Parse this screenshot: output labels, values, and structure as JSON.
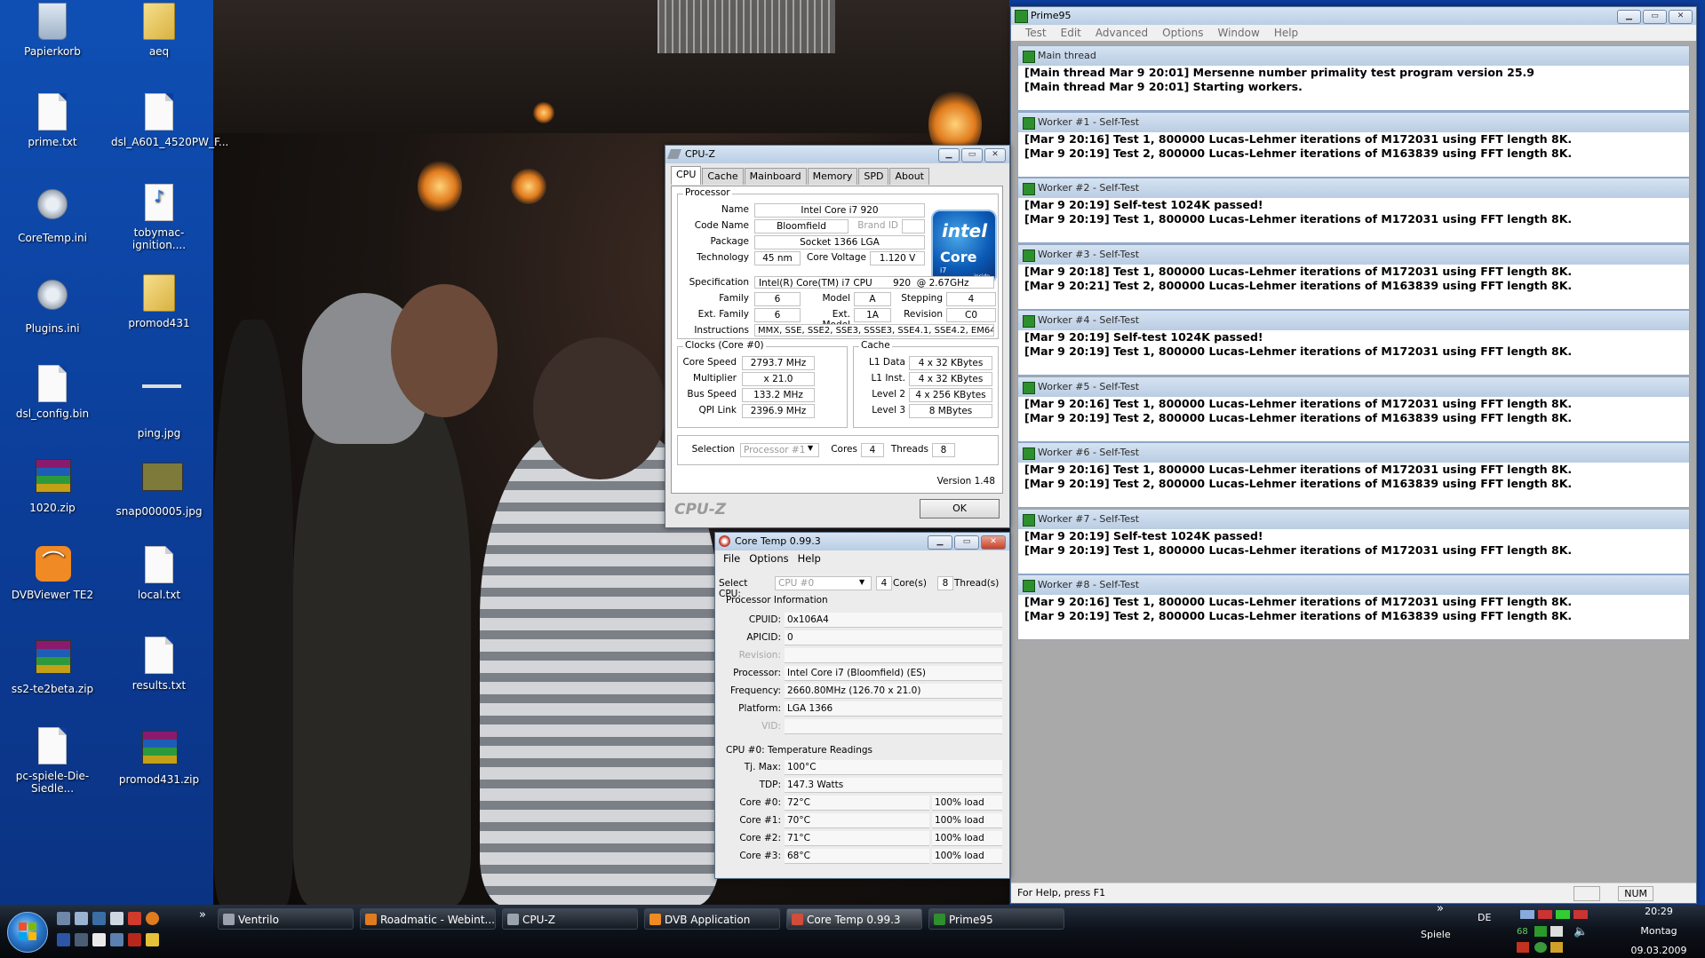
{
  "desktop_icons": [
    {
      "label": "Papierkorb",
      "kind": "recycle-bin"
    },
    {
      "label": "aeq",
      "kind": "folder"
    },
    {
      "label": "prime.txt",
      "kind": "text-file"
    },
    {
      "label": "dsl_A601_4520PW_F...",
      "kind": "text-file"
    },
    {
      "label": "CoreTemp.ini",
      "kind": "ini-file"
    },
    {
      "label": "tobymac-ignition....",
      "kind": "mp3-file"
    },
    {
      "label": "Plugins.ini",
      "kind": "ini-file"
    },
    {
      "label": "promod431",
      "kind": "folder"
    },
    {
      "label": "dsl_config.bin",
      "kind": "text-file"
    },
    {
      "label": "ping.jpg",
      "kind": "image-file"
    },
    {
      "label": "1020.zip",
      "kind": "zip-file"
    },
    {
      "label": "snap000005.jpg",
      "kind": "image-file"
    },
    {
      "label": "DVBViewer TE2",
      "kind": "rss-app"
    },
    {
      "label": "local.txt",
      "kind": "text-file"
    },
    {
      "label": "ss2-te2beta.zip",
      "kind": "zip-file"
    },
    {
      "label": "results.txt",
      "kind": "text-file"
    },
    {
      "label": "pc-spiele-Die-Siedle...",
      "kind": "text-file"
    },
    {
      "label": "promod431.zip",
      "kind": "zip-file"
    }
  ],
  "prime95": {
    "title": "Prime95",
    "menu": [
      "Test",
      "Edit",
      "Advanced",
      "Options",
      "Window",
      "Help"
    ],
    "windows": [
      {
        "title": "Main thread",
        "lines": [
          "[Main thread Mar 9 20:01] Mersenne number primality test program version 25.9",
          "[Main thread Mar 9 20:01] Starting workers."
        ]
      },
      {
        "title": "Worker #1 - Self-Test",
        "lines": [
          "[Mar 9 20:16] Test 1, 800000 Lucas-Lehmer iterations of M172031 using FFT length 8K.",
          "[Mar 9 20:19] Test 2, 800000 Lucas-Lehmer iterations of M163839 using FFT length 8K."
        ]
      },
      {
        "title": "Worker #2 - Self-Test",
        "lines": [
          "[Mar 9 20:19] Self-test 1024K passed!",
          "[Mar 9 20:19] Test 1, 800000 Lucas-Lehmer iterations of M172031 using FFT length 8K."
        ]
      },
      {
        "title": "Worker #3 - Self-Test",
        "lines": [
          "[Mar 9 20:18] Test 1, 800000 Lucas-Lehmer iterations of M172031 using FFT length 8K.",
          "[Mar 9 20:21] Test 2, 800000 Lucas-Lehmer iterations of M163839 using FFT length 8K."
        ]
      },
      {
        "title": "Worker #4 - Self-Test",
        "lines": [
          "[Mar 9 20:19] Self-test 1024K passed!",
          "[Mar 9 20:19] Test 1, 800000 Lucas-Lehmer iterations of M172031 using FFT length 8K."
        ]
      },
      {
        "title": "Worker #5 - Self-Test",
        "lines": [
          "[Mar 9 20:16] Test 1, 800000 Lucas-Lehmer iterations of M172031 using FFT length 8K.",
          "[Mar 9 20:19] Test 2, 800000 Lucas-Lehmer iterations of M163839 using FFT length 8K."
        ]
      },
      {
        "title": "Worker #6 - Self-Test",
        "lines": [
          "[Mar 9 20:16] Test 1, 800000 Lucas-Lehmer iterations of M172031 using FFT length 8K.",
          "[Mar 9 20:19] Test 2, 800000 Lucas-Lehmer iterations of M163839 using FFT length 8K."
        ]
      },
      {
        "title": "Worker #7 - Self-Test",
        "lines": [
          "[Mar 9 20:19] Self-test 1024K passed!",
          "[Mar 9 20:19] Test 1, 800000 Lucas-Lehmer iterations of M172031 using FFT length 8K."
        ]
      },
      {
        "title": "Worker #8 - Self-Test",
        "lines": [
          "[Mar 9 20:16] Test 1, 800000 Lucas-Lehmer iterations of M172031 using FFT length 8K.",
          "[Mar 9 20:19] Test 2, 800000 Lucas-Lehmer iterations of M163839 using FFT length 8K."
        ]
      }
    ],
    "status": "For Help, press F1",
    "num_indicator": "NUM"
  },
  "cpuz": {
    "title": "CPU-Z",
    "tabs": [
      "CPU",
      "Cache",
      "Mainboard",
      "Memory",
      "SPD",
      "About"
    ],
    "processor_group": "Processor",
    "labels": {
      "name": "Name",
      "code_name": "Code Name",
      "brand_id": "Brand ID",
      "package": "Package",
      "technology": "Technology",
      "core_voltage": "Core Voltage",
      "specification": "Specification",
      "family": "Family",
      "model": "Model",
      "stepping": "Stepping",
      "ext_family": "Ext. Family",
      "ext_model": "Ext. Model",
      "revision": "Revision",
      "instructions": "Instructions"
    },
    "values": {
      "name": "Intel Core i7 920",
      "code_name": "Bloomfield",
      "package": "Socket 1366 LGA",
      "technology": "45 nm",
      "core_voltage": "1.120 V",
      "specification": "Intel(R) Core(TM) i7 CPU       920  @ 2.67GHz",
      "family": "6",
      "model": "A",
      "stepping": "4",
      "ext_family": "6",
      "ext_model": "1A",
      "revision": "C0",
      "instructions": "MMX, SSE, SSE2, SSE3, SSSE3, SSE4.1, SSE4.2, EM64T"
    },
    "logo": {
      "brand": "intel",
      "product": "Core",
      "sub": "i7",
      "tag": "inside"
    },
    "clocks_group": "Clocks (Core #0)",
    "clocks": [
      {
        "label": "Core Speed",
        "value": "2793.7 MHz"
      },
      {
        "label": "Multiplier",
        "value": "x 21.0"
      },
      {
        "label": "Bus Speed",
        "value": "133.2 MHz"
      },
      {
        "label": "QPI Link",
        "value": "2396.9 MHz"
      }
    ],
    "cache_group": "Cache",
    "cache": [
      {
        "label": "L1 Data",
        "value": "4 x 32 KBytes"
      },
      {
        "label": "L1 Inst.",
        "value": "4 x 32 KBytes"
      },
      {
        "label": "Level 2",
        "value": "4 x 256 KBytes"
      },
      {
        "label": "Level 3",
        "value": "8 MBytes"
      }
    ],
    "selection_label": "Selection",
    "selection_value": "Processor #1",
    "cores_label": "Cores",
    "cores_value": "4",
    "threads_label": "Threads",
    "threads_value": "8",
    "version": "Version 1.48",
    "brand_text": "CPU-Z",
    "ok_label": "OK"
  },
  "coretemp": {
    "title": "Core Temp 0.99.3",
    "menu": [
      "File",
      "Options",
      "Help"
    ],
    "select_cpu_label": "Select CPU:",
    "select_cpu_value": "CPU #0",
    "cores_value": "4",
    "cores_label": "Core(s)",
    "threads_value": "8",
    "threads_label": "Thread(s)",
    "info_header": "Processor Information",
    "info": [
      {
        "label": "CPUID:",
        "value": "0x106A4"
      },
      {
        "label": "APICID:",
        "value": "0"
      },
      {
        "label": "Revision:",
        "value": ""
      },
      {
        "label": "Processor:",
        "value": "Intel Core i7 (Bloomfield) (ES)"
      },
      {
        "label": "Frequency:",
        "value": "2660.80MHz (126.70 x 21.0)"
      },
      {
        "label": "Platform:",
        "value": "LGA 1366"
      },
      {
        "label": "VID:",
        "value": ""
      }
    ],
    "temp_header": "CPU #0: Temperature Readings",
    "tj_label": "Tj. Max:",
    "tj_value": "100°C",
    "tdp_label": "TDP:",
    "tdp_value": "147.3 Watts",
    "cores": [
      {
        "label": "Core #0:",
        "temp": "72°C",
        "load": "100% load"
      },
      {
        "label": "Core #1:",
        "temp": "70°C",
        "load": "100% load"
      },
      {
        "label": "Core #2:",
        "temp": "71°C",
        "load": "100% load"
      },
      {
        "label": "Core #3:",
        "temp": "68°C",
        "load": "100% load"
      }
    ]
  },
  "taskbar": {
    "tasks": [
      {
        "label": "Ventrilo",
        "color": "#9aa3ad"
      },
      {
        "label": "Roadmatic - Webint...",
        "color": "#e07b1f"
      },
      {
        "label": "CPU-Z",
        "color": "#9aa3ad"
      },
      {
        "label": "DVB Application",
        "color": "#f08a24"
      },
      {
        "label": "Core Temp 0.99.3",
        "color": "#d24c3c"
      },
      {
        "label": "Prime95",
        "color": "#2e8f2e"
      }
    ],
    "more_arrow": "»",
    "toolbar_label": "Spiele",
    "lang": "DE",
    "tray_temps": "68",
    "clock_time": "20:29",
    "clock_day": "Montag",
    "clock_date": "09.03.2009"
  }
}
